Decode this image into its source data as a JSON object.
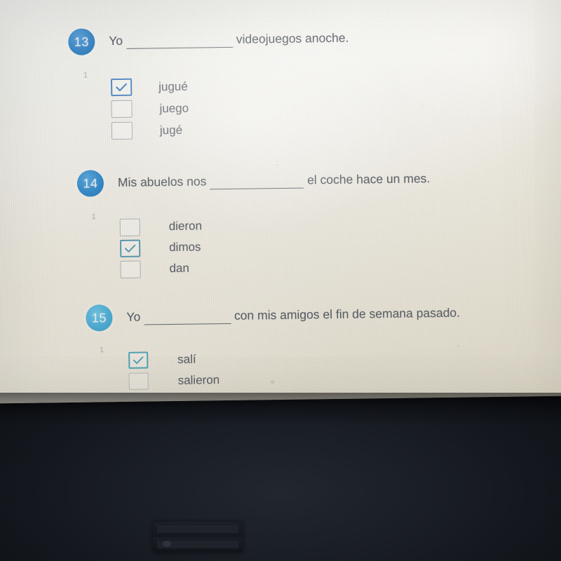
{
  "device": {
    "type": "laptop-photo",
    "screen_background": "#efece3",
    "body_color": "#161a20"
  },
  "colors": {
    "badge_blue": "#2d80c4",
    "badge_blue_light": "#4bafd8",
    "checked_border_blue": "#4a83c4",
    "checked_border_teal": "#5a9ab4",
    "checked_border_teal_light": "#53a7bc",
    "unchecked_border": "#a9adb1",
    "text_grey": "#555b63",
    "points_grey": "#a9aaa6"
  },
  "partial_item_above": {
    "type": "cut-off-checkbox",
    "visible": true
  },
  "questions": [
    {
      "number": "13",
      "points": "1",
      "badge_color": "#2d80c4",
      "text_before": "Yo",
      "text_after": "videojuegos anoche.",
      "options": [
        {
          "label": "jugué",
          "checked": true,
          "border_color": "#4a83c4"
        },
        {
          "label": "juego",
          "checked": false,
          "border_color": "#a9adb1"
        },
        {
          "label": "jugé",
          "checked": false,
          "border_color": "#a9adb1"
        }
      ]
    },
    {
      "number": "14",
      "points": "1",
      "badge_color": "#2d87c9",
      "text_before": "Mis abuelos nos",
      "text_after": "el coche hace un mes.",
      "options": [
        {
          "label": "dieron",
          "checked": false,
          "border_color": "#b0b4b4"
        },
        {
          "label": "dimos",
          "checked": true,
          "border_color": "#5a9ab4"
        },
        {
          "label": "dan",
          "checked": false,
          "border_color": "#b0b4b4"
        }
      ]
    },
    {
      "number": "15",
      "points": "1",
      "badge_color": "#4bafd8",
      "text_before": "Yo",
      "text_after": "con mis amigos el fin de semana pasado.",
      "options": [
        {
          "label": "salí",
          "checked": true,
          "border_color": "#53a7bc"
        },
        {
          "label": "salieron",
          "checked": false,
          "border_color": "#bfc0b8"
        }
      ]
    }
  ]
}
